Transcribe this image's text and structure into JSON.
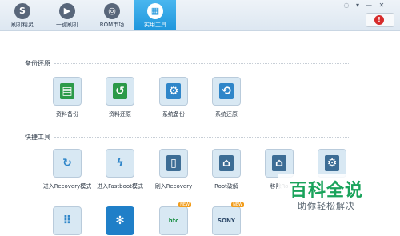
{
  "toolbar": {
    "tabs": [
      {
        "label": "刷机精灵",
        "icon": "logo-s-icon"
      },
      {
        "label": "一键刷机",
        "icon": "play-icon"
      },
      {
        "label": "ROM市场",
        "icon": "rom-icon"
      },
      {
        "label": "实用工具",
        "icon": "grid-icon",
        "active": true
      }
    ],
    "notify_count": "!"
  },
  "sections": {
    "backup_title": "备份还原",
    "quick_title": "快捷工具"
  },
  "backup_tools": [
    {
      "label": "资料备份",
      "icon": "document-copy-icon"
    },
    {
      "label": "资料还原",
      "icon": "document-restore-icon"
    },
    {
      "label": "系统备份",
      "icon": "system-backup-icon"
    },
    {
      "label": "系统还原",
      "icon": "system-restore-icon"
    }
  ],
  "quick_tools": [
    {
      "label": "进入Recovery模式",
      "icon": "refresh-icon"
    },
    {
      "label": "进入Fastboot模式",
      "icon": "lightning-icon"
    },
    {
      "label": "刷入Recovery",
      "icon": "flash-phone-icon"
    },
    {
      "label": "Root破解",
      "icon": "android-icon"
    },
    {
      "label": "移除Ro",
      "icon": "android-remove-icon"
    },
    {
      "label": "",
      "icon": "gears-icon"
    }
  ],
  "bottom_tools": [
    {
      "icon": "dots-grid-icon"
    },
    {
      "icon": "loading-spinner-icon"
    },
    {
      "icon": "htc-unlock-icon",
      "badge": "NEW",
      "text": "htc"
    },
    {
      "icon": "sony-unlock-icon",
      "badge": "NEW",
      "text": "SONY"
    }
  ],
  "watermark": {
    "title": "百科全说",
    "subtitle": "助你轻松解决"
  }
}
